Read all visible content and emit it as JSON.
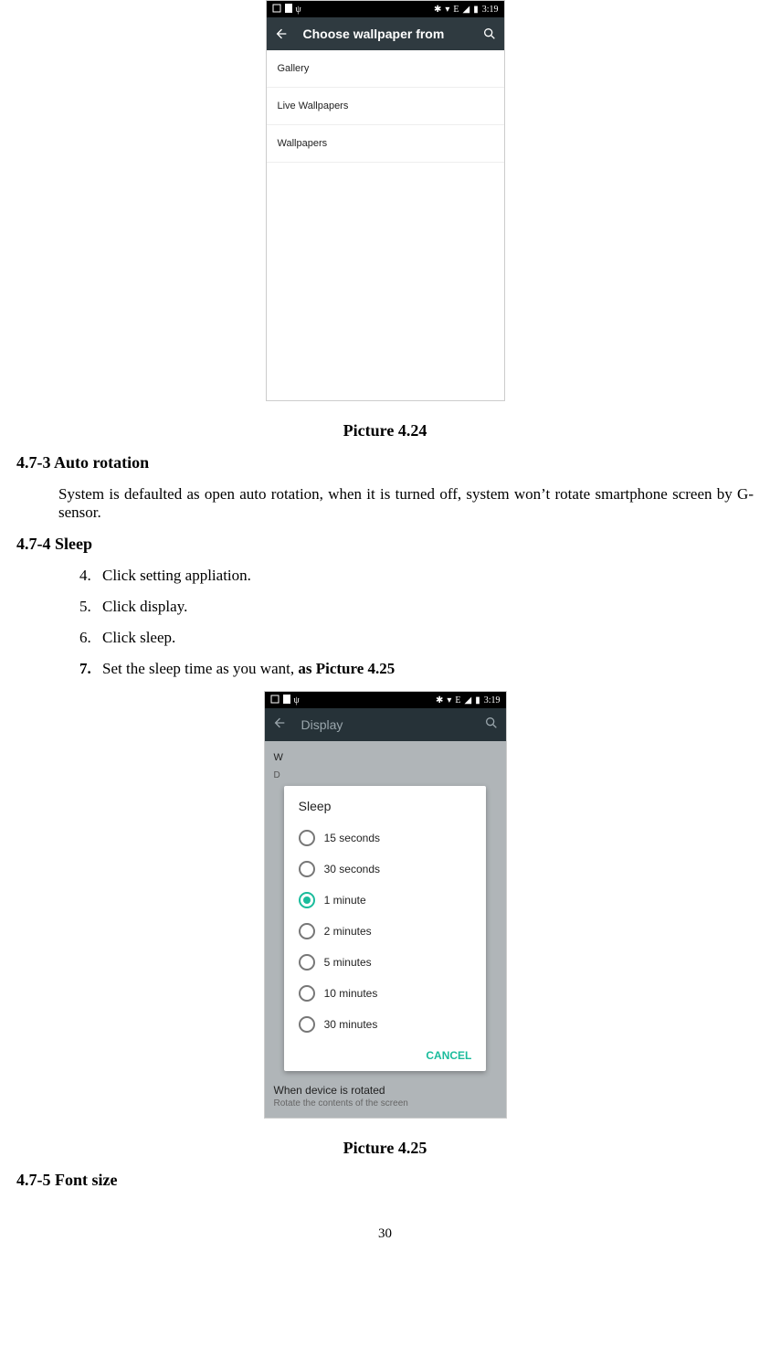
{
  "phone1": {
    "status_time": "3:19",
    "status_net": "E",
    "appbar_title": "Choose wallpaper from",
    "items": [
      "Gallery",
      "Live Wallpapers",
      "Wallpapers"
    ]
  },
  "caption1": "Picture 4.24",
  "sec1": {
    "heading": "4.7-3 Auto rotation",
    "body": "System is defaulted as open auto rotation, when it is turned off, system won’t rotate smartphone screen by G-sensor."
  },
  "sec2": {
    "heading": "4.7-4 Sleep",
    "steps": [
      "Click setting appliation.",
      "Click display.",
      "Click sleep."
    ],
    "step4_prefix": "Set the sleep time as you want, ",
    "step4_bold": "as Picture 4.25"
  },
  "phone2": {
    "status_time": "3:19",
    "status_net": "E",
    "appbar_title": "Display",
    "peek_w": "W",
    "peek_d": "D",
    "dialog_title": "Sleep",
    "options": [
      {
        "label": "15 seconds",
        "selected": false
      },
      {
        "label": "30 seconds",
        "selected": false
      },
      {
        "label": "1 minute",
        "selected": true
      },
      {
        "label": "2 minutes",
        "selected": false
      },
      {
        "label": "5 minutes",
        "selected": false
      },
      {
        "label": "10 minutes",
        "selected": false
      },
      {
        "label": "30 minutes",
        "selected": false
      }
    ],
    "cancel": "CANCEL",
    "rotated_title": "When device is rotated",
    "rotated_sub": "Rotate the contents of the screen"
  },
  "caption2": "Picture 4.25",
  "sec3_heading": "4.7-5 Font size",
  "page_number": "30"
}
